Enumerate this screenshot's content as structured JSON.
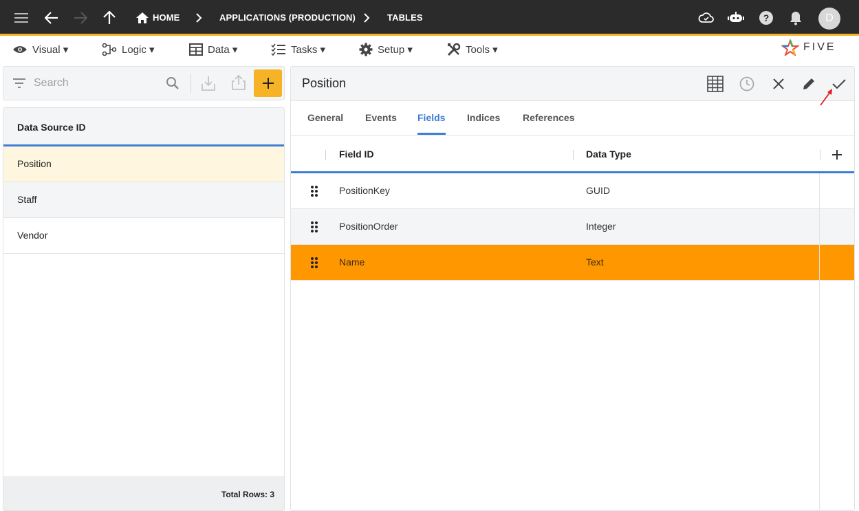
{
  "topbar": {
    "breadcrumb_home": "HOME",
    "breadcrumb_app": "APPLICATIONS (PRODUCTION)",
    "breadcrumb_tables": "TABLES",
    "avatar_initial": "D",
    "icons": [
      "menu-icon",
      "back-icon",
      "forward-icon",
      "up-icon",
      "home-icon",
      "cloud-icon",
      "chat-bot-icon",
      "help-icon",
      "bell-icon"
    ]
  },
  "menu": {
    "visual": "Visual ▾",
    "logic": "Logic ▾",
    "data": "Data ▾",
    "tasks": "Tasks ▾",
    "setup": "Setup ▾",
    "tools": "Tools ▾",
    "logo_text": "FIVE"
  },
  "search": {
    "placeholder": "Search"
  },
  "list": {
    "header": "Data Source ID",
    "rows": [
      "Position",
      "Staff",
      "Vendor"
    ],
    "footer": "Total Rows: 3"
  },
  "detail": {
    "title": "Position",
    "tabs": [
      "General",
      "Events",
      "Fields",
      "Indices",
      "References"
    ],
    "active_tab": "Fields",
    "columns": [
      "Field ID",
      "Data Type"
    ],
    "rows": [
      {
        "field_id": "PositionKey",
        "data_type": "GUID"
      },
      {
        "field_id": "PositionOrder",
        "data_type": "Integer"
      },
      {
        "field_id": "Name",
        "data_type": "Text"
      }
    ],
    "selected_row": "Name"
  },
  "colors": {
    "topbar_bg": "#2b2b2b",
    "accent_yellow": "#f6b325",
    "accent_blue": "#3c7dd6",
    "selected_row": "#ff9800",
    "selected_list_row": "#fff6e0"
  }
}
